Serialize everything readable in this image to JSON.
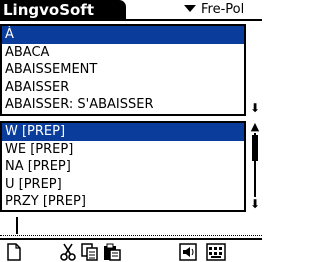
{
  "app": {
    "title": "LingvoSoft"
  },
  "language_picker": {
    "label": "Fre-Pol"
  },
  "word_list": {
    "items": [
      "À",
      "ABACA",
      "ABAISSEMENT",
      "ABAISSER",
      "ABAISSER: S'ABAISSER"
    ],
    "selected_index": 0
  },
  "translation_list": {
    "items": [
      "W [PREP]",
      "WE [PREP]",
      "NA [PREP]",
      "U [PREP]",
      "PRZY [PREP]"
    ],
    "selected_index": 0
  },
  "search": {
    "value": ""
  },
  "toolbar": {
    "icons": [
      "new-document-icon",
      "cut-icon",
      "copy-icon",
      "paste-icon",
      "speaker-icon",
      "keyboard-icon"
    ]
  },
  "colors": {
    "selection": "#0a3c9c",
    "background": "#ffffff",
    "text": "#000000"
  }
}
